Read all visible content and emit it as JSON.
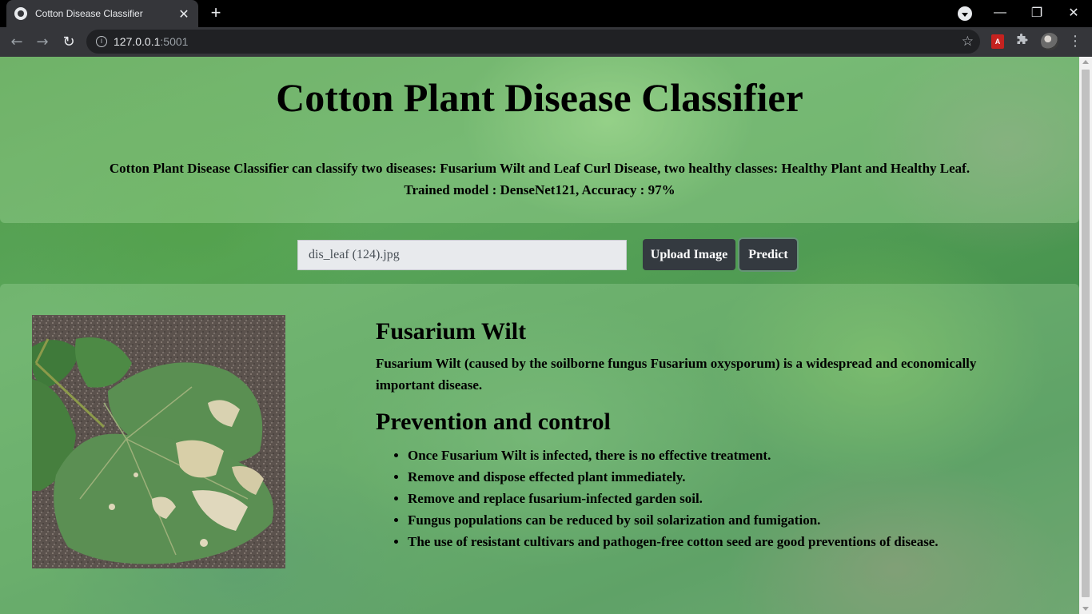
{
  "browser": {
    "tab_title": "Cotton Disease Classifier",
    "tab_close_glyph": "✕",
    "new_tab_glyph": "+",
    "url_host": "127.0.0.1",
    "url_port": ":5001",
    "back_glyph": "←",
    "forward_glyph": "→",
    "reload_glyph": "↻",
    "info_glyph": "i",
    "star_glyph": "☆",
    "pdf_ext_label": "A",
    "menu_glyph": "⋮",
    "minimize_glyph": "—",
    "restore_glyph": "❐",
    "close_glyph": "✕"
  },
  "header": {
    "title": "Cotton Plant Disease Classifier",
    "description_line1": "Cotton Plant Disease Classifier can classify two diseases: Fusarium Wilt and Leaf Curl Disease, two healthy classes: Healthy Plant and Healthy Leaf.",
    "description_line2": "Trained model : DenseNet121, Accuracy : 97%"
  },
  "upload": {
    "file_name": "dis_leaf (124).jpg",
    "upload_label": "Upload Image",
    "predict_label": "Predict"
  },
  "result": {
    "disease_name": "Fusarium Wilt",
    "disease_description": "Fusarium Wilt (caused by the soilborne fungus Fusarium oxysporum) is a widespread and economically important disease.",
    "prevention_heading": "Prevention and control",
    "prevention_tips": [
      "Once Fusarium Wilt is infected, there is no effective treatment.",
      "Remove and dispose effected plant immediately.",
      "Remove and replace fusarium-infected garden soil.",
      "Fungus populations can be reduced by soil solarization and fumigation.",
      "The use of resistant cultivars and pathogen-free cotton seed are good preventions of disease."
    ]
  },
  "icons": {
    "favicon": "globe-icon",
    "back": "arrow-left-icon",
    "forward": "arrow-right-icon",
    "reload": "reload-icon",
    "info": "info-icon",
    "bookmark": "star-icon",
    "pdf_extension": "adobe-pdf-icon",
    "extensions": "puzzle-icon",
    "profile": "avatar-icon",
    "menu": "kebab-menu-icon"
  },
  "colors": {
    "button_bg": "#343a40",
    "input_bg": "#e8eaed",
    "tab_bg": "#35363a"
  }
}
